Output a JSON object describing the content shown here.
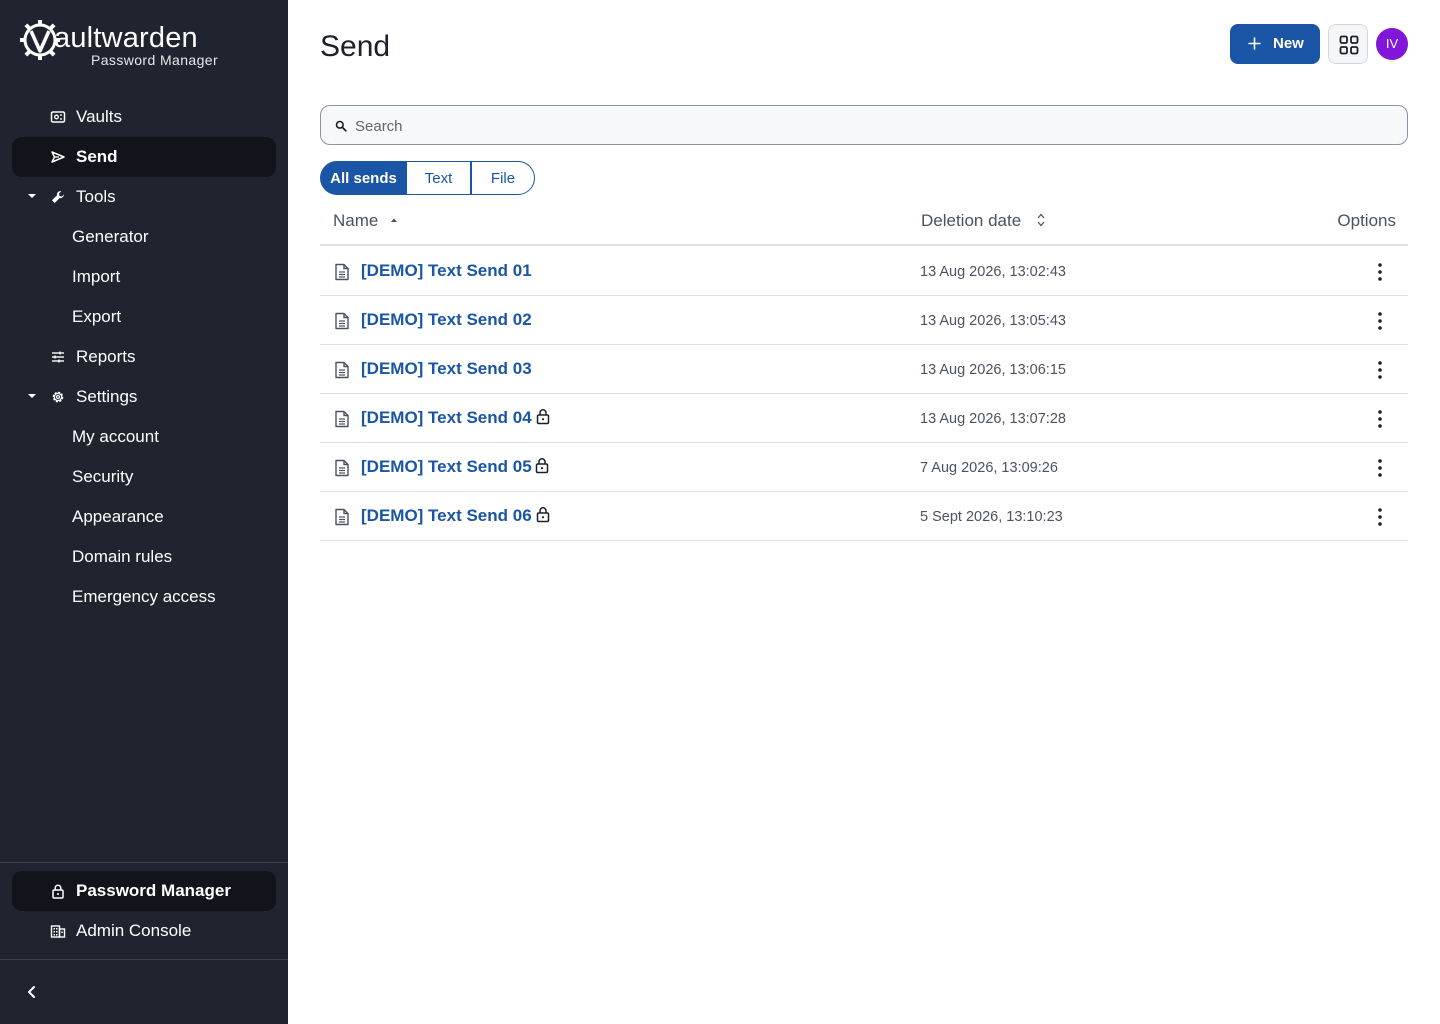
{
  "logo": {
    "wordmark_bold": "V",
    "wordmark_rest": "aultwarden",
    "subtitle": "Password Manager"
  },
  "sidebar": {
    "items": [
      {
        "label": "Vaults",
        "icon": "vault-icon"
      },
      {
        "label": "Send",
        "icon": "send-icon",
        "active": true
      },
      {
        "label": "Tools",
        "icon": "wrench-icon",
        "expanded": true
      },
      {
        "label": "Generator"
      },
      {
        "label": "Import"
      },
      {
        "label": "Export"
      },
      {
        "label": "Reports",
        "icon": "sliders-icon"
      },
      {
        "label": "Settings",
        "icon": "gear-icon",
        "expanded": true
      },
      {
        "label": "My account"
      },
      {
        "label": "Security"
      },
      {
        "label": "Appearance"
      },
      {
        "label": "Domain rules"
      },
      {
        "label": "Emergency access"
      }
    ],
    "products": [
      {
        "label": "Password Manager",
        "icon": "lock-icon",
        "active": true
      },
      {
        "label": "Admin Console",
        "icon": "building-icon"
      }
    ]
  },
  "header": {
    "title": "Send",
    "new_label": "New",
    "avatar_initials": "IV",
    "avatar_color": "#8216d8"
  },
  "search": {
    "placeholder": "Search",
    "value": ""
  },
  "filters": {
    "all": "All sends",
    "text": "Text",
    "file": "File",
    "selected": "All sends"
  },
  "table": {
    "columns": {
      "name": "Name",
      "deletion": "Deletion date",
      "options": "Options"
    },
    "sort": {
      "column": "Name",
      "direction": "ascending"
    },
    "rows": [
      {
        "name": "[DEMO] Text Send 01",
        "deletion_date": "13 Aug 2026, 13:02:43",
        "password_protected": false
      },
      {
        "name": "[DEMO] Text Send 02",
        "deletion_date": "13 Aug 2026, 13:05:43",
        "password_protected": false
      },
      {
        "name": "[DEMO] Text Send 03",
        "deletion_date": "13 Aug 2026, 13:06:15",
        "password_protected": false
      },
      {
        "name": "[DEMO] Text Send 04",
        "deletion_date": "13 Aug 2026, 13:07:28",
        "password_protected": true
      },
      {
        "name": "[DEMO] Text Send 05",
        "deletion_date": "7 Aug 2026, 13:09:26",
        "password_protected": true
      },
      {
        "name": "[DEMO] Text Send 06",
        "deletion_date": "5 Sept 2026, 13:10:23",
        "password_protected": true
      }
    ]
  },
  "colors": {
    "sidebar_bg": "#1f242e",
    "accent": "#1a56a5",
    "link": "#1a56a5"
  }
}
